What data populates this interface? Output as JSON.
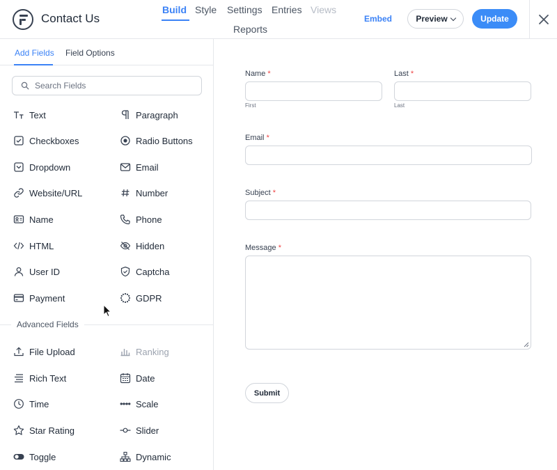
{
  "header": {
    "title": "Contact Us",
    "nav": {
      "build": "Build",
      "style": "Style",
      "settings": "Settings",
      "entries": "Entries",
      "views": "Views",
      "reports": "Reports"
    },
    "embed": "Embed",
    "preview": "Preview",
    "update": "Update",
    "accent_color": "#3b82f6"
  },
  "sidebar": {
    "tabs": {
      "add_fields": "Add Fields",
      "field_options": "Field Options"
    },
    "search_placeholder": "Search Fields",
    "fields": [
      {
        "label": "Text",
        "icon": "text-icon"
      },
      {
        "label": "Paragraph",
        "icon": "paragraph-icon"
      },
      {
        "label": "Checkboxes",
        "icon": "checkbox-icon"
      },
      {
        "label": "Radio Buttons",
        "icon": "radio-icon"
      },
      {
        "label": "Dropdown",
        "icon": "dropdown-icon"
      },
      {
        "label": "Email",
        "icon": "envelope-icon"
      },
      {
        "label": "Website/URL",
        "icon": "link-icon"
      },
      {
        "label": "Number",
        "icon": "hash-icon"
      },
      {
        "label": "Name",
        "icon": "id-card-icon"
      },
      {
        "label": "Phone",
        "icon": "phone-icon"
      },
      {
        "label": "HTML",
        "icon": "code-icon"
      },
      {
        "label": "Hidden",
        "icon": "eye-slash-icon"
      },
      {
        "label": "User ID",
        "icon": "user-icon"
      },
      {
        "label": "Captcha",
        "icon": "shield-icon"
      },
      {
        "label": "Payment",
        "icon": "credit-card-icon"
      },
      {
        "label": "GDPR",
        "icon": "gdpr-stars-icon"
      }
    ],
    "advanced_heading": "Advanced Fields",
    "advanced_fields": [
      {
        "label": "File Upload",
        "icon": "upload-icon"
      },
      {
        "label": "Ranking",
        "icon": "ranking-icon"
      },
      {
        "label": "Rich Text",
        "icon": "rich-text-icon"
      },
      {
        "label": "Date",
        "icon": "calendar-icon"
      },
      {
        "label": "Time",
        "icon": "clock-icon"
      },
      {
        "label": "Scale",
        "icon": "scale-icon"
      },
      {
        "label": "Star Rating",
        "icon": "star-icon"
      },
      {
        "label": "Slider",
        "icon": "slider-icon"
      },
      {
        "label": "Toggle",
        "icon": "toggle-icon"
      },
      {
        "label": "Dynamic",
        "icon": "hierarchy-icon"
      }
    ]
  },
  "form": {
    "required_mark": "*",
    "name_label": "Name",
    "last_label": "Last",
    "first_sub": "First",
    "last_sub": "Last",
    "email_label": "Email",
    "subject_label": "Subject",
    "message_label": "Message",
    "submit": "Submit",
    "required_color": "#ef4444"
  }
}
